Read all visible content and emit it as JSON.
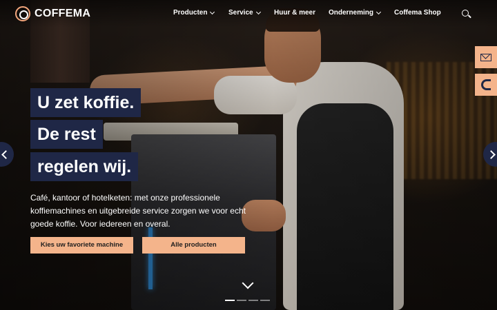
{
  "brand": {
    "name": "COFFEMA",
    "accent": "#f4b48b",
    "navy": "#1f2746"
  },
  "nav": {
    "items": [
      {
        "label": "Producten",
        "has_dropdown": true
      },
      {
        "label": "Service",
        "has_dropdown": true
      },
      {
        "label": "Huur & meer",
        "has_dropdown": false
      },
      {
        "label": "Onderneming",
        "has_dropdown": true
      },
      {
        "label": "Coffema Shop",
        "has_dropdown": false
      }
    ],
    "search_icon": "search-icon"
  },
  "hero": {
    "headline": [
      "U zet koffie.",
      "De rest",
      "regelen wij."
    ],
    "lead": "Café, kantoor of hotelketen: met onze professionele koffiemachines en uitgebreide service zorgen we voor echt goede koffie. Voor iedereen en overal.",
    "buttons": {
      "primary": "Kies uw favoriete machine",
      "secondary": "Alle producten"
    }
  },
  "side_tabs": {
    "icons": [
      "mail-icon",
      "phone-icon"
    ]
  },
  "carousel": {
    "slides": 4,
    "active_index": 0
  }
}
